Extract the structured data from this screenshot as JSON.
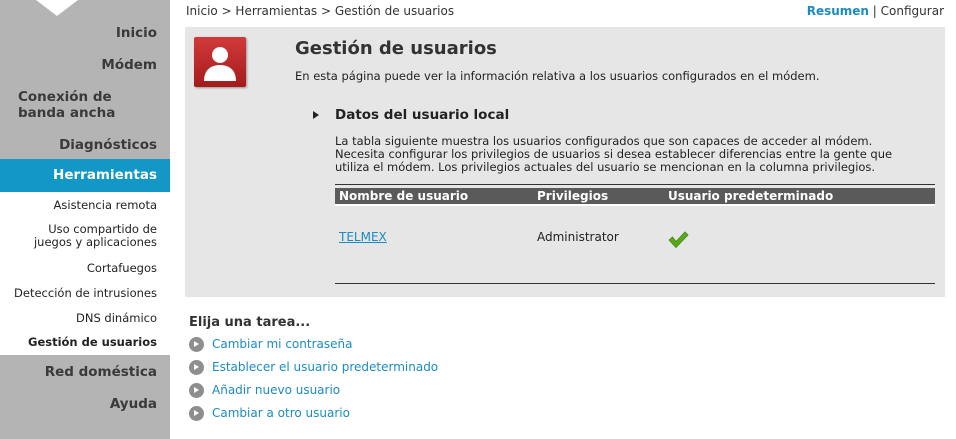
{
  "sidebar": {
    "items": [
      {
        "label": "Inicio"
      },
      {
        "label": "Módem"
      },
      {
        "label": "Conexión de banda ancha"
      },
      {
        "label": "Diagnósticos"
      },
      {
        "label": "Herramientas",
        "active": true
      },
      {
        "label": "Red doméstica"
      },
      {
        "label": "Ayuda"
      }
    ],
    "subitems": [
      {
        "label": "Asistencia remota"
      },
      {
        "label": "Uso compartido de juegos y aplicaciones"
      },
      {
        "label": "Cortafuegos"
      },
      {
        "label": "Detección de intrusiones"
      },
      {
        "label": "DNS dinámico"
      },
      {
        "label": "Gestión de usuarios",
        "current": true
      }
    ]
  },
  "header": {
    "breadcrumb": "Inicio > Herramientas > Gestión de usuarios",
    "view_summary": "Resumen",
    "view_separator": "|",
    "view_configure": "Configurar"
  },
  "main": {
    "title": "Gestión de usuarios",
    "intro": "En esta página puede ver la información relativa a los usuarios configurados en el módem.",
    "section_title": "Datos del usuario local",
    "section_desc": "La tabla siguiente muestra los usuarios configurados que son capaces de acceder al módem. Necesita configurar los privilegios de usuarios si desea establecer diferencias entre la gente que utiliza el módem. Los privilegios actuales del usuario se mencionan en la columna privilegios.",
    "table": {
      "columns": [
        "Nombre de usuario",
        "Privilegios",
        "Usuario predeterminado"
      ],
      "rows": [
        {
          "username": "TELMEX",
          "privileges": "Administrator",
          "is_default": true
        }
      ]
    }
  },
  "tasks": {
    "heading": "Elija una tarea...",
    "items": [
      {
        "label": "Cambiar mi contraseña"
      },
      {
        "label": "Establecer el usuario predeterminado"
      },
      {
        "label": "Añadir nuevo usuario"
      },
      {
        "label": "Cambiar a otro usuario"
      }
    ]
  },
  "icons": {
    "user_icon": "user-silhouette-icon",
    "default_check": "green-checkmark-icon",
    "task_bullet": "arrow-circle-icon"
  },
  "colors": {
    "accent": "#1297c7",
    "link": "#1c8bc0",
    "panel_bg": "#e6e6e6",
    "sidebar_bg": "#b4b4b4",
    "table_header_bg": "#5a5a5a",
    "icon_red": "#c0272d",
    "check_green": "#5aa91c"
  }
}
